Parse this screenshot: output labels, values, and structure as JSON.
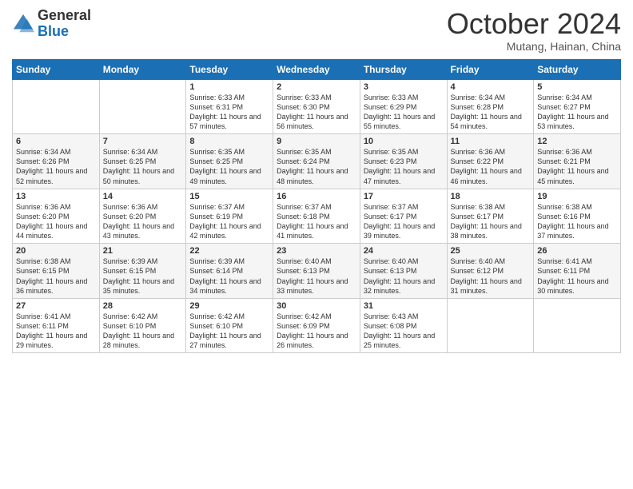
{
  "header": {
    "logo": {
      "general": "General",
      "blue": "Blue"
    },
    "title": "October 2024",
    "subtitle": "Mutang, Hainan, China"
  },
  "weekdays": [
    "Sunday",
    "Monday",
    "Tuesday",
    "Wednesday",
    "Thursday",
    "Friday",
    "Saturday"
  ],
  "weeks": [
    [
      {
        "day": "",
        "sunrise": "",
        "sunset": "",
        "daylight": ""
      },
      {
        "day": "",
        "sunrise": "",
        "sunset": "",
        "daylight": ""
      },
      {
        "day": "1",
        "sunrise": "Sunrise: 6:33 AM",
        "sunset": "Sunset: 6:31 PM",
        "daylight": "Daylight: 11 hours and 57 minutes."
      },
      {
        "day": "2",
        "sunrise": "Sunrise: 6:33 AM",
        "sunset": "Sunset: 6:30 PM",
        "daylight": "Daylight: 11 hours and 56 minutes."
      },
      {
        "day": "3",
        "sunrise": "Sunrise: 6:33 AM",
        "sunset": "Sunset: 6:29 PM",
        "daylight": "Daylight: 11 hours and 55 minutes."
      },
      {
        "day": "4",
        "sunrise": "Sunrise: 6:34 AM",
        "sunset": "Sunset: 6:28 PM",
        "daylight": "Daylight: 11 hours and 54 minutes."
      },
      {
        "day": "5",
        "sunrise": "Sunrise: 6:34 AM",
        "sunset": "Sunset: 6:27 PM",
        "daylight": "Daylight: 11 hours and 53 minutes."
      }
    ],
    [
      {
        "day": "6",
        "sunrise": "Sunrise: 6:34 AM",
        "sunset": "Sunset: 6:26 PM",
        "daylight": "Daylight: 11 hours and 52 minutes."
      },
      {
        "day": "7",
        "sunrise": "Sunrise: 6:34 AM",
        "sunset": "Sunset: 6:25 PM",
        "daylight": "Daylight: 11 hours and 50 minutes."
      },
      {
        "day": "8",
        "sunrise": "Sunrise: 6:35 AM",
        "sunset": "Sunset: 6:25 PM",
        "daylight": "Daylight: 11 hours and 49 minutes."
      },
      {
        "day": "9",
        "sunrise": "Sunrise: 6:35 AM",
        "sunset": "Sunset: 6:24 PM",
        "daylight": "Daylight: 11 hours and 48 minutes."
      },
      {
        "day": "10",
        "sunrise": "Sunrise: 6:35 AM",
        "sunset": "Sunset: 6:23 PM",
        "daylight": "Daylight: 11 hours and 47 minutes."
      },
      {
        "day": "11",
        "sunrise": "Sunrise: 6:36 AM",
        "sunset": "Sunset: 6:22 PM",
        "daylight": "Daylight: 11 hours and 46 minutes."
      },
      {
        "day": "12",
        "sunrise": "Sunrise: 6:36 AM",
        "sunset": "Sunset: 6:21 PM",
        "daylight": "Daylight: 11 hours and 45 minutes."
      }
    ],
    [
      {
        "day": "13",
        "sunrise": "Sunrise: 6:36 AM",
        "sunset": "Sunset: 6:20 PM",
        "daylight": "Daylight: 11 hours and 44 minutes."
      },
      {
        "day": "14",
        "sunrise": "Sunrise: 6:36 AM",
        "sunset": "Sunset: 6:20 PM",
        "daylight": "Daylight: 11 hours and 43 minutes."
      },
      {
        "day": "15",
        "sunrise": "Sunrise: 6:37 AM",
        "sunset": "Sunset: 6:19 PM",
        "daylight": "Daylight: 11 hours and 42 minutes."
      },
      {
        "day": "16",
        "sunrise": "Sunrise: 6:37 AM",
        "sunset": "Sunset: 6:18 PM",
        "daylight": "Daylight: 11 hours and 41 minutes."
      },
      {
        "day": "17",
        "sunrise": "Sunrise: 6:37 AM",
        "sunset": "Sunset: 6:17 PM",
        "daylight": "Daylight: 11 hours and 39 minutes."
      },
      {
        "day": "18",
        "sunrise": "Sunrise: 6:38 AM",
        "sunset": "Sunset: 6:17 PM",
        "daylight": "Daylight: 11 hours and 38 minutes."
      },
      {
        "day": "19",
        "sunrise": "Sunrise: 6:38 AM",
        "sunset": "Sunset: 6:16 PM",
        "daylight": "Daylight: 11 hours and 37 minutes."
      }
    ],
    [
      {
        "day": "20",
        "sunrise": "Sunrise: 6:38 AM",
        "sunset": "Sunset: 6:15 PM",
        "daylight": "Daylight: 11 hours and 36 minutes."
      },
      {
        "day": "21",
        "sunrise": "Sunrise: 6:39 AM",
        "sunset": "Sunset: 6:15 PM",
        "daylight": "Daylight: 11 hours and 35 minutes."
      },
      {
        "day": "22",
        "sunrise": "Sunrise: 6:39 AM",
        "sunset": "Sunset: 6:14 PM",
        "daylight": "Daylight: 11 hours and 34 minutes."
      },
      {
        "day": "23",
        "sunrise": "Sunrise: 6:40 AM",
        "sunset": "Sunset: 6:13 PM",
        "daylight": "Daylight: 11 hours and 33 minutes."
      },
      {
        "day": "24",
        "sunrise": "Sunrise: 6:40 AM",
        "sunset": "Sunset: 6:13 PM",
        "daylight": "Daylight: 11 hours and 32 minutes."
      },
      {
        "day": "25",
        "sunrise": "Sunrise: 6:40 AM",
        "sunset": "Sunset: 6:12 PM",
        "daylight": "Daylight: 11 hours and 31 minutes."
      },
      {
        "day": "26",
        "sunrise": "Sunrise: 6:41 AM",
        "sunset": "Sunset: 6:11 PM",
        "daylight": "Daylight: 11 hours and 30 minutes."
      }
    ],
    [
      {
        "day": "27",
        "sunrise": "Sunrise: 6:41 AM",
        "sunset": "Sunset: 6:11 PM",
        "daylight": "Daylight: 11 hours and 29 minutes."
      },
      {
        "day": "28",
        "sunrise": "Sunrise: 6:42 AM",
        "sunset": "Sunset: 6:10 PM",
        "daylight": "Daylight: 11 hours and 28 minutes."
      },
      {
        "day": "29",
        "sunrise": "Sunrise: 6:42 AM",
        "sunset": "Sunset: 6:10 PM",
        "daylight": "Daylight: 11 hours and 27 minutes."
      },
      {
        "day": "30",
        "sunrise": "Sunrise: 6:42 AM",
        "sunset": "Sunset: 6:09 PM",
        "daylight": "Daylight: 11 hours and 26 minutes."
      },
      {
        "day": "31",
        "sunrise": "Sunrise: 6:43 AM",
        "sunset": "Sunset: 6:08 PM",
        "daylight": "Daylight: 11 hours and 25 minutes."
      },
      {
        "day": "",
        "sunrise": "",
        "sunset": "",
        "daylight": ""
      },
      {
        "day": "",
        "sunrise": "",
        "sunset": "",
        "daylight": ""
      }
    ]
  ]
}
